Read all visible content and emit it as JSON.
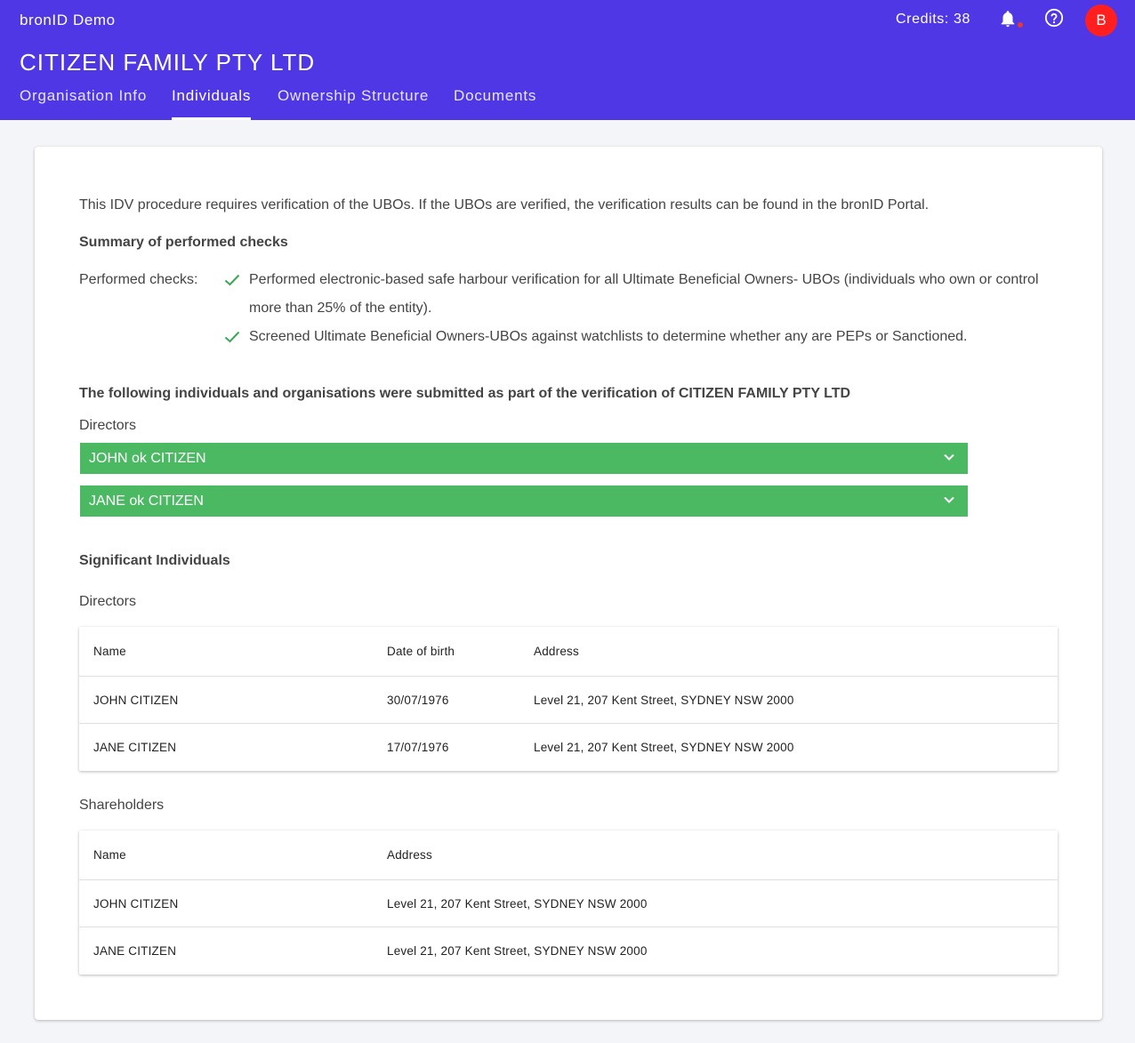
{
  "header": {
    "app_name": "bronID Demo",
    "credits": "Credits: 38",
    "avatar_initial": "B",
    "org_title": "CITIZEN FAMILY PTY LTD",
    "tabs": [
      {
        "label": "Organisation Info"
      },
      {
        "label": "Individuals"
      },
      {
        "label": "Ownership Structure"
      },
      {
        "label": "Documents"
      }
    ],
    "active_tab": "Individuals"
  },
  "main": {
    "intro": "This IDV procedure requires verification of the UBOs. If the UBOs are verified, the verification results can be found in the bronID Portal.",
    "summary_title": "Summary of performed checks",
    "checks_label": "Performed checks:",
    "checks": [
      {
        "line1": "Performed electronic-based safe harbour verification for all Ultimate Beneficial Owners- UBOs (individuals who own or control",
        "line2": "more than 25% of the entity)."
      },
      {
        "line1": "Screened Ultimate Beneficial Owners-UBOs against watchlists to determine whether any are PEPs or Sanctioned.",
        "line2": ""
      }
    ],
    "submitted_title": "The following individuals and organisations were submitted as part of the verification of CITIZEN FAMILY PTY LTD",
    "directors_label": "Directors",
    "director_accordions": [
      {
        "label": "JOHN ok CITIZEN"
      },
      {
        "label": "JANE ok CITIZEN"
      }
    ],
    "significant_title": "Significant Individuals",
    "sig_directors_label": "Directors",
    "directors_table": {
      "headers": {
        "name": "Name",
        "dob": "Date of birth",
        "address": "Address"
      },
      "rows": [
        {
          "name": "JOHN CITIZEN",
          "dob": "30/07/1976",
          "address": "Level 21, 207 Kent Street, SYDNEY NSW 2000"
        },
        {
          "name": "JANE CITIZEN",
          "dob": "17/07/1976",
          "address": "Level 21, 207 Kent Street, SYDNEY NSW 2000"
        }
      ]
    },
    "shareholders_label": "Shareholders",
    "shareholders_table": {
      "headers": {
        "name": "Name",
        "address": "Address"
      },
      "rows": [
        {
          "name": "JOHN CITIZEN",
          "address": "Level 21, 207 Kent Street, SYDNEY NSW 2000"
        },
        {
          "name": "JANE CITIZEN",
          "address": "Level 21, 207 Kent Street, SYDNEY NSW 2000"
        }
      ]
    }
  },
  "colors": {
    "header_bg": "#4f37e6",
    "accordion_green": "#4bb862",
    "check_green": "#3aa757",
    "avatar_red": "#ff1f1f",
    "notification_dot": "#e53935"
  },
  "icons": {
    "notifications": "bell-icon",
    "help": "help-circle-icon",
    "check": "check-icon",
    "expand": "chevron-down-icon"
  }
}
